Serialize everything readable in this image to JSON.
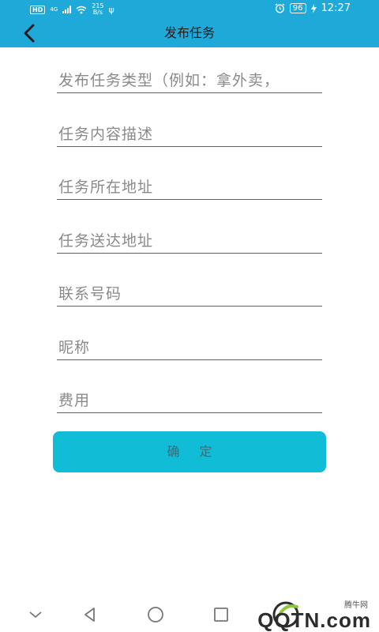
{
  "status_bar": {
    "hd": "HD",
    "network": "4G",
    "speed_value": "215",
    "speed_unit": "B/s",
    "usb": "ψ",
    "battery": "96",
    "time": "12:27"
  },
  "header": {
    "title": "发布任务"
  },
  "form": {
    "fields": [
      {
        "placeholder": "发布任务类型（例如：拿外卖，",
        "value": ""
      },
      {
        "placeholder": "任务内容描述",
        "value": ""
      },
      {
        "placeholder": "任务所在地址",
        "value": ""
      },
      {
        "placeholder": "任务送达地址",
        "value": ""
      },
      {
        "placeholder": "联系号码",
        "value": ""
      },
      {
        "placeholder": "昵称",
        "value": ""
      },
      {
        "placeholder": "费用",
        "value": ""
      }
    ],
    "confirm_label": "确 定"
  },
  "watermark": {
    "small": "腾牛网",
    "text": "QQTN.com"
  },
  "colors": {
    "header": "#1ea9d9",
    "button": "#10bcd6",
    "input_line": "#5f5f5f"
  }
}
